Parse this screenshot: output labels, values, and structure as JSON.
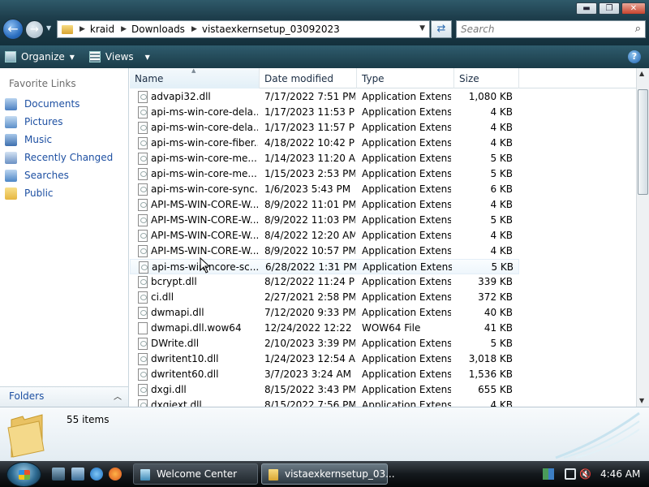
{
  "window": {
    "controls": {
      "minimize": "▬",
      "maximize": "❐",
      "close": "✕"
    }
  },
  "address": {
    "crumbs": [
      "kraid",
      "Downloads",
      "vistaexkernsetup_03092023"
    ],
    "separator": "▶",
    "dropdown": "▼"
  },
  "search": {
    "placeholder": "Search"
  },
  "toolbar": {
    "organize_label": "Organize",
    "views_label": "Views",
    "help": "?"
  },
  "nav": {
    "favorites_title": "Favorite Links",
    "items": [
      {
        "label": "Documents",
        "icon": "documents-icon",
        "color": "#4a7fc1"
      },
      {
        "label": "Pictures",
        "icon": "pictures-icon",
        "color": "#5b8fc9"
      },
      {
        "label": "Music",
        "icon": "music-icon",
        "color": "#3d6fae"
      },
      {
        "label": "Recently Changed",
        "icon": "recent-icon",
        "color": "#6a91c4"
      },
      {
        "label": "Searches",
        "icon": "searches-icon",
        "color": "#4c86c6"
      },
      {
        "label": "Public",
        "icon": "public-folder-icon",
        "color": "#e6b640"
      }
    ],
    "folders_label": "Folders"
  },
  "columns": {
    "name": "Name",
    "date": "Date modified",
    "type": "Type",
    "size": "Size"
  },
  "files": [
    {
      "name": "advapi32.dll",
      "date": "7/17/2022 7:51 PM",
      "type": "Application Extens...",
      "size": "1,080 KB"
    },
    {
      "name": "api-ms-win-core-dela...",
      "date": "1/17/2023 11:53 PM",
      "type": "Application Extens...",
      "size": "4 KB"
    },
    {
      "name": "api-ms-win-core-dela...",
      "date": "1/17/2023 11:57 PM",
      "type": "Application Extens...",
      "size": "4 KB"
    },
    {
      "name": "api-ms-win-core-fiber...",
      "date": "4/18/2022 10:42 PM",
      "type": "Application Extens...",
      "size": "4 KB"
    },
    {
      "name": "api-ms-win-core-me...",
      "date": "1/14/2023 11:20 AM",
      "type": "Application Extens...",
      "size": "5 KB"
    },
    {
      "name": "api-ms-win-core-me...",
      "date": "1/15/2023 2:53 PM",
      "type": "Application Extens...",
      "size": "5 KB"
    },
    {
      "name": "api-ms-win-core-sync...",
      "date": "1/6/2023 5:43 PM",
      "type": "Application Extens...",
      "size": "6 KB"
    },
    {
      "name": "API-MS-WIN-CORE-W...",
      "date": "8/9/2022 11:01 PM",
      "type": "Application Extens...",
      "size": "4 KB"
    },
    {
      "name": "API-MS-WIN-CORE-W...",
      "date": "8/9/2022 11:03 PM",
      "type": "Application Extens...",
      "size": "5 KB"
    },
    {
      "name": "API-MS-WIN-CORE-W...",
      "date": "8/4/2022 12:20 AM",
      "type": "Application Extens...",
      "size": "4 KB"
    },
    {
      "name": "API-MS-WIN-CORE-W...",
      "date": "8/9/2022 10:57 PM",
      "type": "Application Extens...",
      "size": "4 KB"
    },
    {
      "name": "api-ms-win-ncore-sc...",
      "date": "6/28/2022 1:31 PM",
      "type": "Application Extens...",
      "size": "5 KB",
      "hover": true
    },
    {
      "name": "bcrypt.dll",
      "date": "8/12/2022 11:24 PM",
      "type": "Application Extens...",
      "size": "339 KB"
    },
    {
      "name": "ci.dll",
      "date": "2/27/2021 2:58 PM",
      "type": "Application Extens...",
      "size": "372 KB"
    },
    {
      "name": "dwmapi.dll",
      "date": "7/12/2020 9:33 PM",
      "type": "Application Extens...",
      "size": "40 KB"
    },
    {
      "name": "dwmapi.dll.wow64",
      "date": "12/24/2022 12:22 ...",
      "type": "WOW64 File",
      "size": "41 KB",
      "plain": true
    },
    {
      "name": "DWrite.dll",
      "date": "2/10/2023 3:39 PM",
      "type": "Application Extens...",
      "size": "5 KB"
    },
    {
      "name": "dwritent10.dll",
      "date": "1/24/2023 12:54 AM",
      "type": "Application Extens...",
      "size": "3,018 KB"
    },
    {
      "name": "dwritent60.dll",
      "date": "3/7/2023 3:24 AM",
      "type": "Application Extens...",
      "size": "1,536 KB"
    },
    {
      "name": "dxgi.dll",
      "date": "8/15/2022 3:43 PM",
      "type": "Application Extens...",
      "size": "655 KB"
    },
    {
      "name": "dxgiext.dll",
      "date": "8/15/2022 7:56 PM",
      "type": "Application Extens...",
      "size": "4 KB"
    }
  ],
  "details": {
    "item_count": "55 items"
  },
  "taskbar": {
    "tasks": [
      {
        "label": "Welcome Center",
        "active": false
      },
      {
        "label": "vistaexkernsetup_03...",
        "active": true
      }
    ],
    "clock": "4:46 AM"
  }
}
